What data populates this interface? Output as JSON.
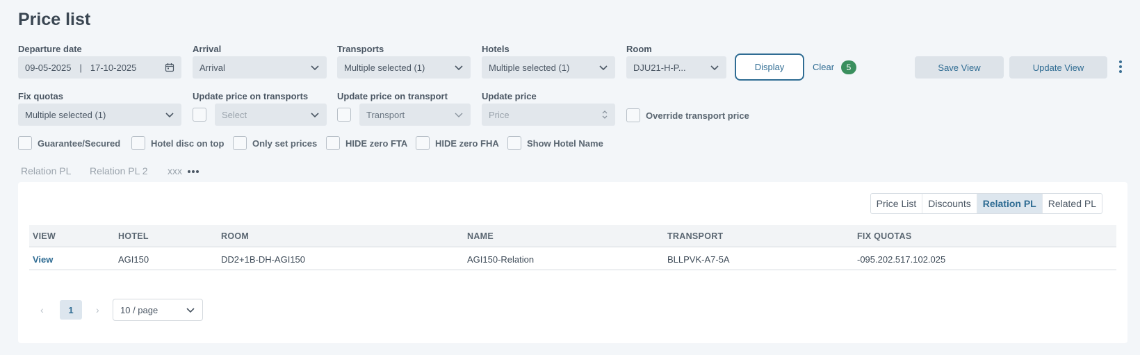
{
  "page_title": "Price list",
  "filters": {
    "departure_label": "Departure date",
    "departure_from": "09-05-2025",
    "departure_sep": "|",
    "departure_to": "17-10-2025",
    "arrival_label": "Arrival",
    "arrival_value": "Arrival",
    "transports_label": "Transports",
    "transports_value": "Multiple selected (1)",
    "hotels_label": "Hotels",
    "hotels_value": "Multiple selected (1)",
    "room_label": "Room",
    "room_value": "DJU21-H-P...",
    "display_label": "Display",
    "clear_label": "Clear",
    "clear_count": "5",
    "save_view_label": "Save View",
    "update_view_label": "Update View",
    "fix_quotas_label": "Fix quotas",
    "fix_quotas_value": "Multiple selected (1)",
    "update_transports_label": "Update price on transports",
    "update_transports_placeholder": "Select",
    "update_transport_label": "Update price on transport",
    "update_transport_value": "Transport",
    "update_price_label": "Update price",
    "update_price_placeholder": "Price",
    "override_label": "Override transport price"
  },
  "checkboxes": [
    "Guarantee/Secured",
    "Hotel disc on top",
    "Only set prices",
    "HIDE zero FTA",
    "HIDE zero FHA",
    "Show Hotel Name"
  ],
  "view_tabs": [
    "Relation PL",
    "Relation PL 2",
    "xxx"
  ],
  "segmented": [
    "Price List",
    "Discounts",
    "Relation PL",
    "Related PL"
  ],
  "segmented_active": "Relation PL",
  "table": {
    "headers": [
      "VIEW",
      "HOTEL",
      "ROOM",
      "NAME",
      "TRANSPORT",
      "FIX QUOTAS"
    ],
    "rows": [
      [
        "View",
        "AGI150",
        "DD2+1B-DH-AGI150",
        "AGI150-Relation",
        "BLLPVK-A7-5A",
        "-095.202.517.102.025"
      ]
    ]
  },
  "pagination": {
    "current_page": "1",
    "page_size": "10 / page",
    "prev": "‹",
    "next": "›"
  },
  "colors": {
    "accent": "#2f6c93",
    "badge": "#3a8f5e",
    "background": "#f3f6f9"
  }
}
